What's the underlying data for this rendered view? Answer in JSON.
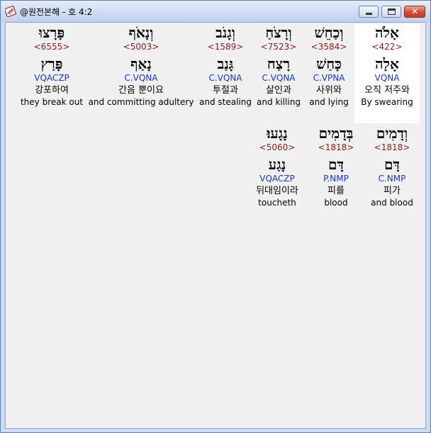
{
  "window": {
    "title": "@원전본해 - 호 4:2",
    "icon": "bible-book-icon",
    "buttons": {
      "minimize": "minimize-icon",
      "maximize": "maximize-icon",
      "close": "✕"
    }
  },
  "colors": {
    "strong": "#8b1a1a",
    "morph": "#1a35c8",
    "selected_bg": "#ffffff"
  },
  "verse": "호 4:2",
  "words": [
    {
      "hebrew": "אָלֹה",
      "strong": "<422>",
      "lemma": "אָלָה",
      "morph": "VQNA",
      "korean": "오직 저주와",
      "english": "By swearing",
      "selected": true
    },
    {
      "hebrew": "וְכַחֵשׁ",
      "strong": "<3584>",
      "lemma": "כָּחַשׁ",
      "morph": "C.VPNA",
      "korean": "사위와",
      "english": "and lying"
    },
    {
      "hebrew": "וְרָצֹחַ",
      "strong": "<7523>",
      "lemma": "רָצַח",
      "morph": "C.VQNA",
      "korean": "살인과",
      "english": "and killing"
    },
    {
      "hebrew": "וְגָנֹב",
      "strong": "<1589>",
      "lemma": "גָּנַב",
      "morph": "C.VQNA",
      "korean": "투절과",
      "english": "and stealing"
    },
    {
      "hebrew": "וְנָאֹף",
      "strong": "<5003>",
      "lemma": "נָאַף",
      "morph": "C.VQNA",
      "korean": "간음 뿐이요",
      "english": "and committing adultery"
    },
    {
      "hebrew": "פָּרָצוּ",
      "strong": "<6555>",
      "lemma": "פָּרַץ",
      "morph": "VQACZP",
      "korean": "강포하여",
      "english": "they break out"
    },
    {
      "hebrew": "וְדָמִים",
      "strong": "<1818>",
      "lemma": "דָּם",
      "morph": "C.NMP",
      "korean": "피가",
      "english": "and blood"
    },
    {
      "hebrew": "בְּדָמִים",
      "strong": "<1818>",
      "lemma": "דָּם",
      "morph": "P.NMP",
      "korean": "피를",
      "english": "blood"
    },
    {
      "hebrew": "נָגָעוּ׃",
      "strong": "<5060>",
      "lemma": "נָגַע",
      "morph": "VQACZP",
      "korean": "뒤대임이라",
      "english": "toucheth"
    }
  ]
}
